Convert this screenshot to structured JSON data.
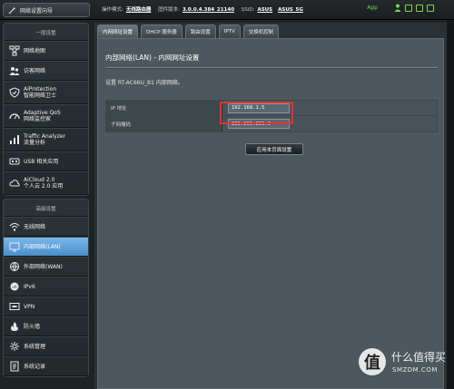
{
  "topbar": {
    "quick_setup_label": "网络设置向导",
    "op_mode_label": "操作模式:",
    "op_mode_value": "无线路由器",
    "firmware_label": "固件版本:",
    "firmware_value": "3.0.0.4.384_21140",
    "ssid_label": "SSID:",
    "ssid_1": "ASUS",
    "ssid_2": "ASUS_5G",
    "app_label": "App"
  },
  "sidebar": {
    "general_header": "一般设置",
    "general_items": [
      {
        "label": "网络地图",
        "icon": "network-map-icon"
      },
      {
        "label": "访客网络",
        "icon": "guest-network-icon"
      },
      {
        "label": "AiProtection",
        "label2": "智能网络卫士",
        "icon": "aiprotection-icon"
      },
      {
        "label": "Adaptive QoS",
        "label2": "网络监控家",
        "icon": "qos-icon"
      },
      {
        "label": "Traffic Analyzer",
        "label2": "流量分析",
        "icon": "traffic-analyzer-icon"
      },
      {
        "label": "USB 相关应用",
        "icon": "usb-icon"
      },
      {
        "label": "AiCloud 2.0",
        "label2": "个人云 2.0 应用",
        "icon": "aicloud-icon"
      }
    ],
    "advanced_header": "高级设置",
    "advanced_items": [
      {
        "label": "无线网络",
        "icon": "wireless-icon"
      },
      {
        "label": "内部网络(LAN)",
        "icon": "lan-icon",
        "active": true
      },
      {
        "label": "外部网络(WAN)",
        "icon": "wan-icon"
      },
      {
        "label": "IPv6",
        "icon": "ipv6-icon"
      },
      {
        "label": "VPN",
        "icon": "vpn-icon"
      },
      {
        "label": "防火墙",
        "icon": "firewall-icon"
      },
      {
        "label": "系统管理",
        "icon": "administration-icon"
      },
      {
        "label": "系统记录",
        "icon": "system-log-icon"
      }
    ]
  },
  "tabs": [
    "内网网址设置",
    "DHCP 服务器",
    "路由设置",
    "IPTV",
    "交换机控制"
  ],
  "panel": {
    "title": "内部网络(LAN) - 内网网址设置",
    "description": "设置 RT-AC66U_B1 内部网络。",
    "fields": [
      {
        "label": "IP 地址",
        "value": "192.168.1.5"
      },
      {
        "label": "子网掩码",
        "value": "255.255.255.0"
      }
    ],
    "apply_label": "应用本页面设置"
  },
  "watermark": {
    "glyph": "值",
    "cn": "什么值得买",
    "en": "SMZDM.COM"
  },
  "colors": {
    "active_item": "#5a9fd8",
    "highlight_box": "#e0342e",
    "status_green": "#7ad94c"
  }
}
